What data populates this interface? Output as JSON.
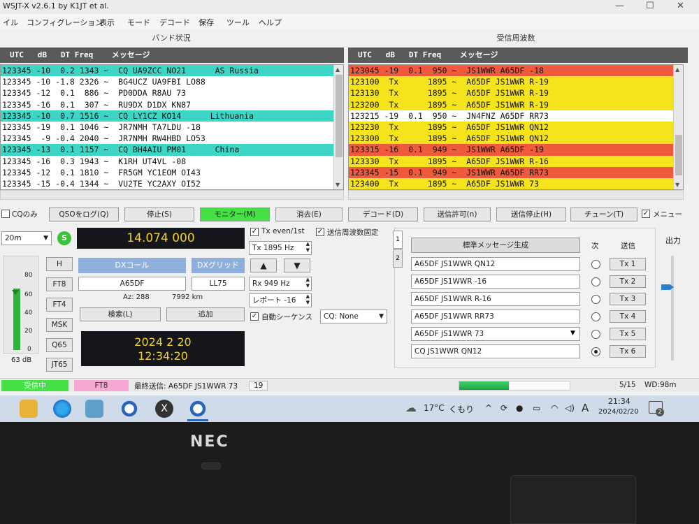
{
  "window": {
    "title": "WSJT-X   v2.6.1   by K1JT et al.",
    "buttons": [
      "—",
      "☐",
      "✕"
    ]
  },
  "menu": [
    "イル",
    "コンフィグレーション",
    "表示",
    "モード",
    "デコード",
    "保存",
    "ツール",
    "ヘルプ"
  ],
  "band_activity": {
    "title": "バンド状況",
    "header": "UTC   dB   DT Freq    メッセージ",
    "rows": [
      {
        "text": "123345 -10  0.2 1343 ~  CQ UA9ZCC NO21      AS Russia",
        "bg": "#3dd6c6"
      },
      {
        "text": "123345 -10 -1.8 2326 ~  BG4UCZ UA9FBI LO88",
        "bg": "#ffffff"
      },
      {
        "text": "123345 -12  0.1  886 ~  PD0DDA R8AU 73",
        "bg": "#ffffff"
      },
      {
        "text": "123345 -16  0.1  307 ~  RU9DX D1DX KN87",
        "bg": "#ffffff"
      },
      {
        "text": "123345 -10  0.7 1516 ~  CQ LY1CZ KO14      Lithuania",
        "bg": "#3dd6c6"
      },
      {
        "text": "123345 -19  0.1 1046 ~  JR7NMH TA7LDU -18",
        "bg": "#ffffff"
      },
      {
        "text": "123345  -9 -0.4 2040 ~  JR7NMH RW4HBD LO53",
        "bg": "#ffffff"
      },
      {
        "text": "123345 -13  0.1 1157 ~  CQ BH4AIU PM01      China",
        "bg": "#3dd6c6"
      },
      {
        "text": "123345 -16  0.3 1943 ~  K1RH UT4VL -08",
        "bg": "#ffffff"
      },
      {
        "text": "123345 -12  0.1 1810 ~  FR5GM YC1EOM OI43",
        "bg": "#ffffff"
      },
      {
        "text": "123345 -15 -0.4 1344 ~  VU2TE YC2AXY OI52",
        "bg": "#ffffff"
      }
    ]
  },
  "rx_frequency": {
    "title": "受信周波数",
    "header": "UTC   dB   DT Freq    メッセージ",
    "rows": [
      {
        "text": "123045 -19  0.1  950 ~  JS1WWR A65DF -18",
        "bg": "#f05a3c"
      },
      {
        "text": "123100  Tx      1895 ~  A65DF JS1WWR R-19",
        "bg": "#f5e31c"
      },
      {
        "text": "123130  Tx      1895 ~  A65DF JS1WWR R-19",
        "bg": "#f5e31c"
      },
      {
        "text": "123200  Tx      1895 ~  A65DF JS1WWR R-19",
        "bg": "#f5e31c"
      },
      {
        "text": "123215 -19  0.1  950 ~  JN4FNZ A65DF RR73",
        "bg": "#ffffff"
      },
      {
        "text": "123230  Tx      1895 ~  A65DF JS1WWR QN12",
        "bg": "#f5e31c"
      },
      {
        "text": "123300  Tx      1895 ~  A65DF JS1WWR QN12",
        "bg": "#f5e31c"
      },
      {
        "text": "123315 -16  0.1  949 ~  JS1WWR A65DF -19",
        "bg": "#f05a3c"
      },
      {
        "text": "123330  Tx      1895 ~  A65DF JS1WWR R-16",
        "bg": "#f5e31c"
      },
      {
        "text": "123345 -15  0.1  949 ~  JS1WWR A65DF RR73",
        "bg": "#f05a3c"
      },
      {
        "text": "123400  Tx      1895 ~  A65DF JS1WWR 73",
        "bg": "#f5e31c"
      }
    ]
  },
  "buttons": {
    "cq_only": "CQのみ",
    "log_qso": "QSOをログ(Q)",
    "stop": "停止(S)",
    "monitor": "モニター(M)",
    "erase": "消去(E)",
    "decode": "デコード(D)",
    "enable_tx": "送信許可(n)",
    "halt_tx": "送信停止(H)",
    "tune": "チューン(T)",
    "menus": "メニュー"
  },
  "left": {
    "band": "20m",
    "s_meter": "S",
    "frequency": "14.074 000",
    "modes": [
      "H",
      "FT8",
      "FT4",
      "MSK",
      "Q65",
      "JT65"
    ],
    "meter_ticks": [
      "80",
      "60",
      "40",
      "20",
      "0"
    ],
    "meter_level_db": 63,
    "db_label": "63 dB"
  },
  "dx": {
    "call_btn": "DXコール",
    "grid_btn": "DXグリッド",
    "call": "A65DF",
    "grid": "LL75",
    "az": "Az: 288",
    "dist": "7992 km",
    "lookup": "検索(L)",
    "add": "追加",
    "date": "2024 2 20",
    "time": "12:34:20"
  },
  "tx_settings": {
    "tx_even": "Tx even/1st",
    "hold_tx": "送信周波数固定",
    "tx_freq": "Tx  1895  Hz",
    "rx_freq": "Rx  949  Hz",
    "report": "レポート -16",
    "auto_seq": "自動シーケンス",
    "cq_select": "CQ: None",
    "up": "▲",
    "down": "▼"
  },
  "messages": {
    "gen_std": "標準メッセージ生成",
    "next_label": "次",
    "send_label": "送信",
    "tab1": "1",
    "tab2": "2",
    "items": [
      {
        "text": "A65DF JS1WWR QN12",
        "btn": "Tx 1",
        "selected": false
      },
      {
        "text": "A65DF JS1WWR -16",
        "btn": "Tx 2",
        "selected": false
      },
      {
        "text": "A65DF JS1WWR R-16",
        "btn": "Tx 3",
        "selected": false
      },
      {
        "text": "A65DF JS1WWR RR73",
        "btn": "Tx 4",
        "selected": false
      },
      {
        "text": "A65DF JS1WWR 73",
        "btn": "Tx 5",
        "selected": false
      },
      {
        "text": "CQ JS1WWR QN12",
        "btn": "Tx 6",
        "selected": true
      }
    ]
  },
  "power_label": "出力",
  "power_level": 0.7,
  "status": {
    "receiving": "受信中",
    "mode": "FT8",
    "last_tx": "最終送信: A65DF JS1WWR 73",
    "count": "19",
    "progress": 0.45,
    "period": "5/15",
    "wd": "WD:98m"
  },
  "taskbar": {
    "temp": "17°C",
    "weather": "くもり",
    "time": "21:34",
    "date": "2024/02/20",
    "ime": "A",
    "notif": "2"
  },
  "laptop_logo": "NEC",
  "colors": {
    "cq": "#3dd6c6",
    "tx": "#f5e31c",
    "rx": "#f05a3c",
    "monitor": "#44e044",
    "receiving": "#44e044",
    "mode_pink": "#f6a9d3"
  }
}
